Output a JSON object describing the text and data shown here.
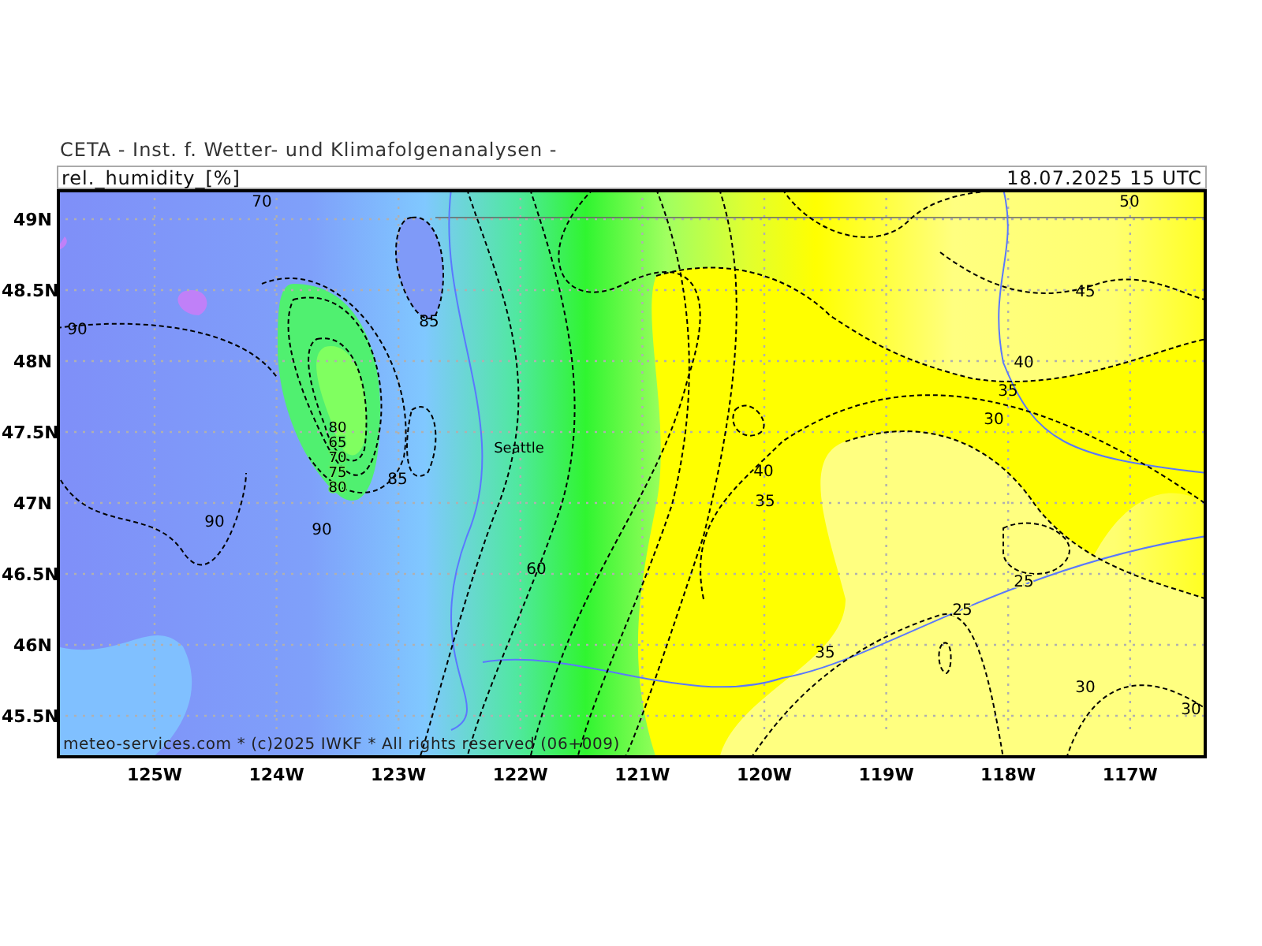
{
  "header": {
    "title": "CETA - Inst. f. Wetter- und Klimafolgenanalysen -",
    "field": "rel._humidity_[%]",
    "valid_time": "18.07.2025 15 UTC"
  },
  "map": {
    "place_labels": [
      "Seattle"
    ],
    "contour_labels": [
      "70",
      "50",
      "85",
      "45",
      "90",
      "40",
      "35",
      "30",
      "80",
      "65",
      "70",
      "75",
      "80",
      "85",
      "40",
      "35",
      "90",
      "90",
      "60",
      "25",
      "25",
      "35",
      "30",
      "30"
    ],
    "copyright": "meteo-services.com * (c)2025 IWKF * All rights reserved (06+009)"
  },
  "axes": {
    "latitudes": [
      "49N",
      "48.5N",
      "48N",
      "47.5N",
      "47N",
      "46.5N",
      "46N",
      "45.5N"
    ],
    "longitudes": [
      "125W",
      "124W",
      "123W",
      "122W",
      "121W",
      "120W",
      "119W",
      "118W",
      "117W"
    ]
  }
}
